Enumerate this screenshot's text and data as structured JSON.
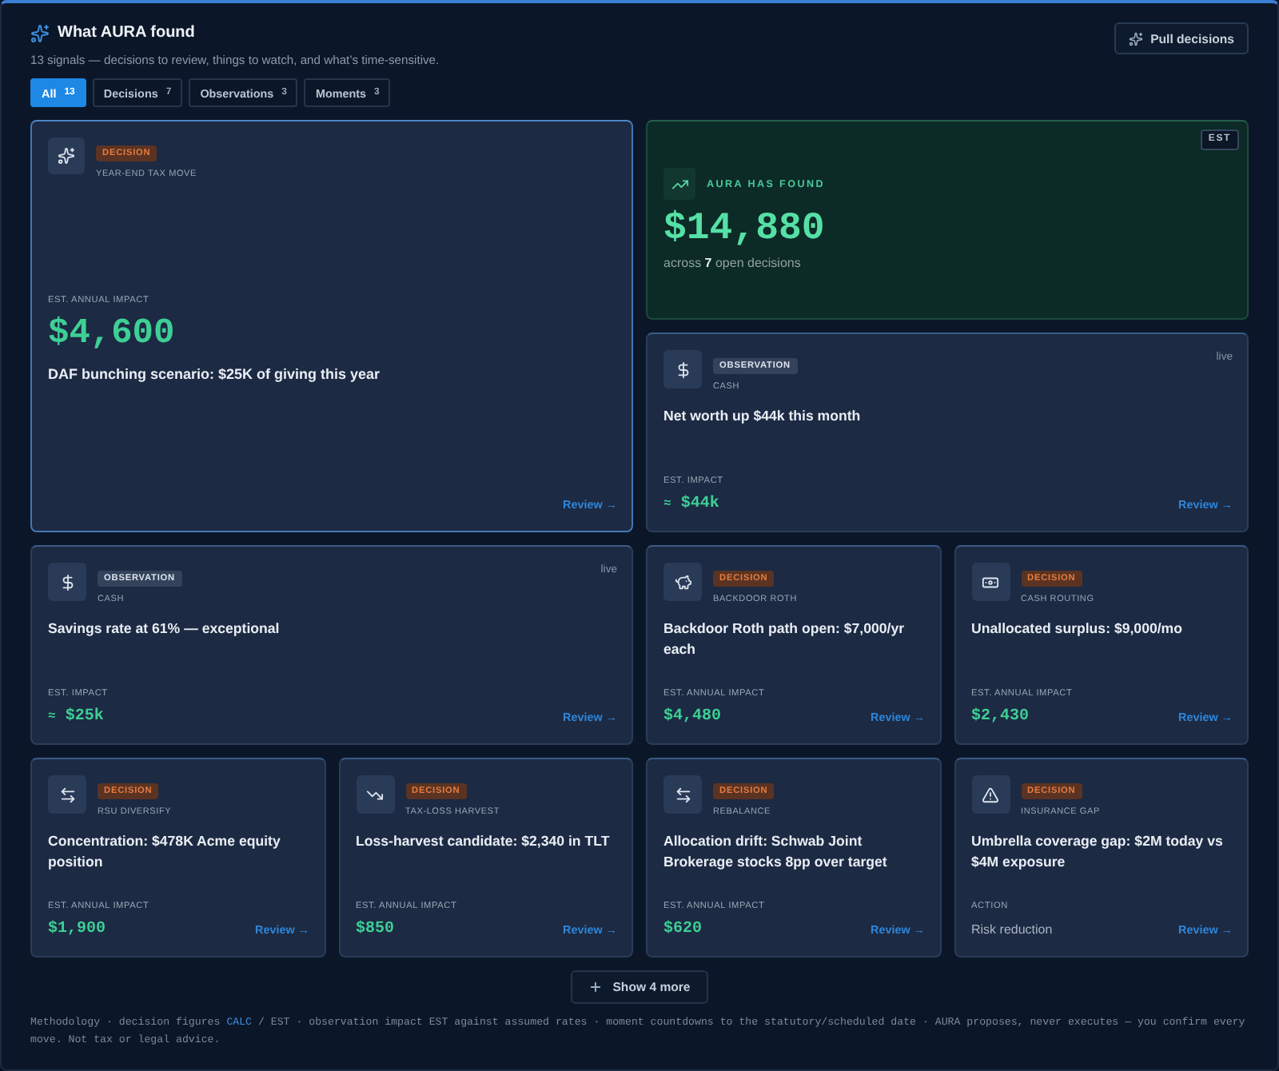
{
  "header": {
    "title": "What AURA found",
    "subtitle": "13 signals — decisions to review, things to watch, and what’s time-sensitive.",
    "action": "Pull decisions"
  },
  "tabs": [
    {
      "label": "All",
      "count": "13",
      "selected": true
    },
    {
      "label": "Decisions",
      "count": "7",
      "selected": false
    },
    {
      "label": "Observations",
      "count": "3",
      "selected": false
    },
    {
      "label": "Moments",
      "count": "3",
      "selected": false
    }
  ],
  "cards": [
    {
      "kind": "featured",
      "tag": "DECISION",
      "category": "YEAR-END TAX MOVE",
      "title": "DAF bunching scenario: $25K of giving this year",
      "impact": {
        "kind": "money",
        "label": "EST. ANNUAL IMPACT",
        "value": "$4,600"
      },
      "link": "Review →"
    },
    {
      "kind": "hero",
      "badge": "EST",
      "label": "AURA HAS FOUND",
      "value": "$14,880",
      "caption": "across **7** open decisions"
    },
    {
      "kind": "observation",
      "tag": "OBSERVATION",
      "category": "CASH",
      "status": "live",
      "title": "Net worth up $44k this month",
      "impact": {
        "kind": "money",
        "label": "EST. IMPACT",
        "prefix": "≈",
        "value": "$44k"
      },
      "link": "Review →"
    },
    {
      "kind": "observation",
      "tag": "OBSERVATION",
      "category": "CASH",
      "status": "live",
      "title": "Savings rate at 61% — exceptional",
      "impact": {
        "kind": "money",
        "label": "EST. IMPACT",
        "prefix": "≈",
        "value": "$25k"
      },
      "link": "Review →"
    },
    {
      "kind": "decision",
      "tag": "DECISION",
      "category": "BACKDOOR ROTH",
      "title": "Backdoor Roth path open: $7,000/yr each",
      "impact": {
        "kind": "money",
        "label": "EST. ANNUAL IMPACT",
        "value": "$4,480"
      },
      "link": "Review →"
    },
    {
      "kind": "decision",
      "tag": "DECISION",
      "category": "CASH ROUTING",
      "title": "Unallocated surplus: $9,000/mo",
      "impact": {
        "kind": "money",
        "label": "EST. ANNUAL IMPACT",
        "value": "$2,430"
      },
      "link": "Review →"
    },
    {
      "kind": "decision",
      "tag": "DECISION",
      "category": "RSU DIVERSIFY",
      "title": "Concentration: $478K Acme equity position",
      "impact": {
        "kind": "money",
        "label": "EST. ANNUAL IMPACT",
        "value": "$1,900"
      },
      "link": "Review →"
    },
    {
      "kind": "decision",
      "tag": "DECISION",
      "category": "TAX-LOSS HARVEST",
      "title": "Loss-harvest candidate: $2,340 in TLT",
      "impact": {
        "kind": "money",
        "label": "EST. ANNUAL IMPACT",
        "value": "$850"
      },
      "link": "Review →"
    },
    {
      "kind": "decision",
      "tag": "DECISION",
      "category": "REBALANCE",
      "title": "Allocation drift: Schwab Joint Brokerage stocks 8pp over target",
      "impact": {
        "kind": "money",
        "label": "EST. ANNUAL IMPACT",
        "value": "$620"
      },
      "link": "Review →"
    },
    {
      "kind": "decision",
      "tag": "DECISION",
      "category": "INSURANCE GAP",
      "title": "Umbrella coverage gap: $2M today vs $4M exposure",
      "impact": {
        "kind": "text",
        "label": "ACTION",
        "value": "Risk reduction"
      },
      "link": "Review →"
    }
  ],
  "more_button": "Show 4 more",
  "footnote": {
    "before": "Methodology · decision figures",
    "highlight": "CALC",
    "after": "/ EST · observation impact EST against assumed rates · moment countdowns to the statutory/scheduled date · AURA proposes, never executes — you confirm every move. Not tax or legal advice."
  }
}
